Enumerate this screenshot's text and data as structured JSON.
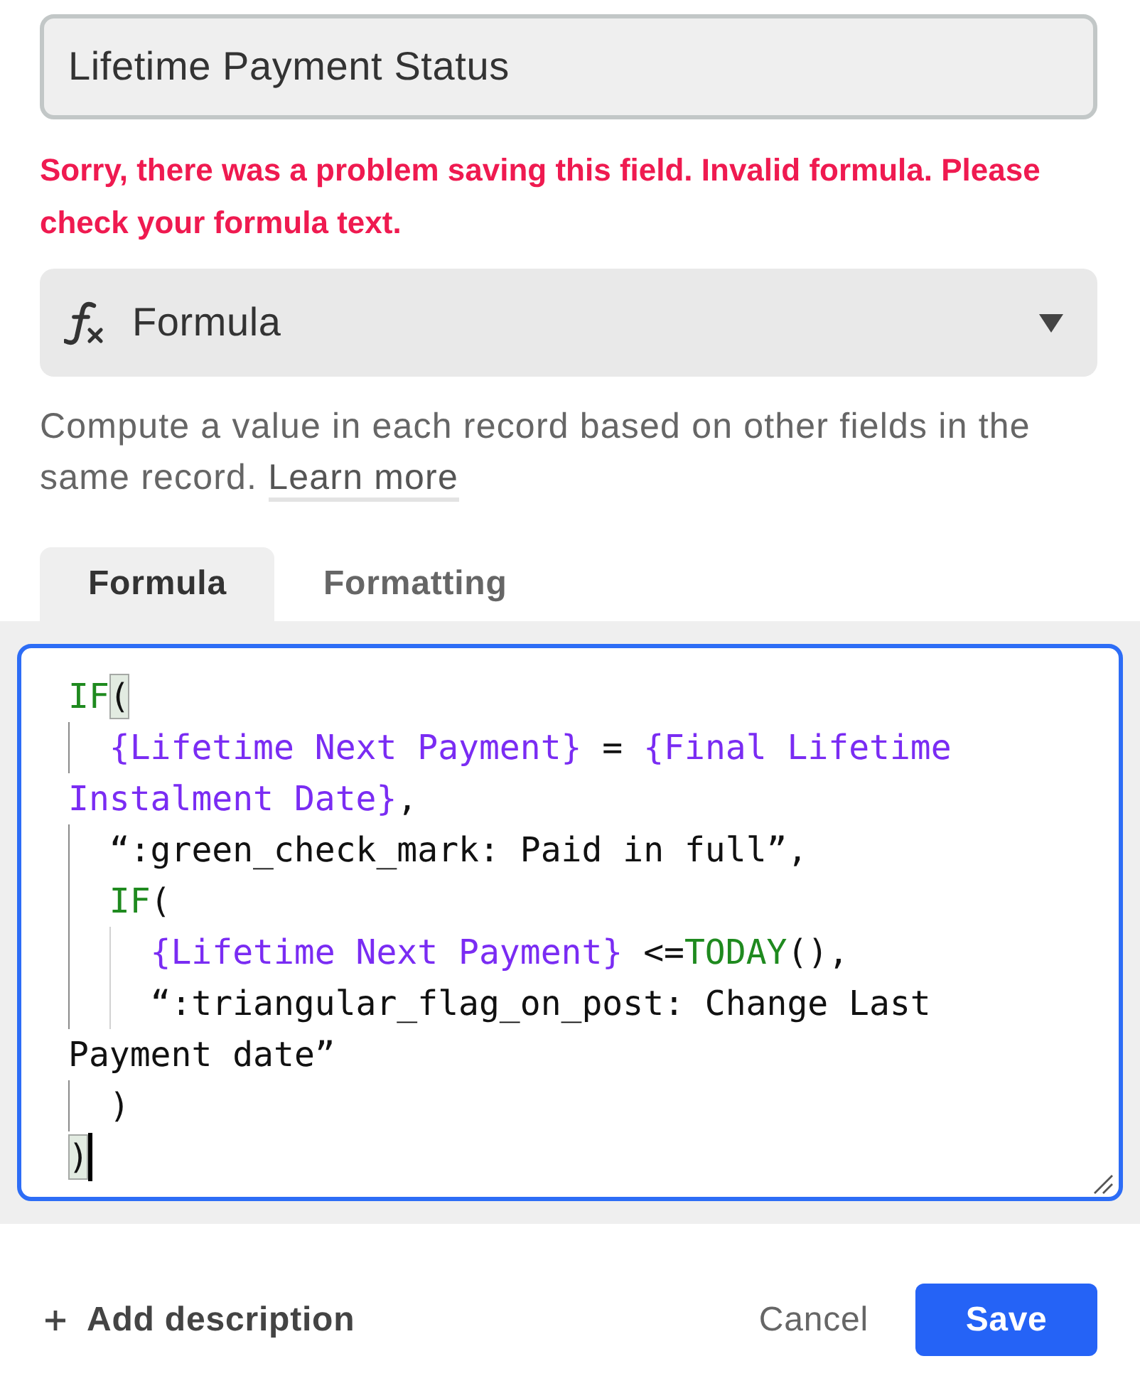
{
  "field_name": {
    "value": "Lifetime Payment Status"
  },
  "error_message": "Sorry, there was a problem saving this field. Invalid formula. Please check your formula text.",
  "field_type": {
    "label": "Formula"
  },
  "description": {
    "text": "Compute a value in each record based on other fields in the same record.",
    "link": "Learn more"
  },
  "tabs": [
    {
      "label": "Formula",
      "selected": true
    },
    {
      "label": "Formatting",
      "selected": false
    }
  ],
  "formula_editor": {
    "lines": [
      {
        "tokens": [
          {
            "kind": "function",
            "text": "IF"
          },
          {
            "kind": "matched_bracket",
            "text": "("
          }
        ]
      },
      {
        "tokens": [
          {
            "kind": "indent",
            "highlighted": true
          },
          {
            "kind": "field",
            "text": "{Lifetime Next Payment}"
          },
          {
            "kind": "plain",
            "text": " = "
          },
          {
            "kind": "field",
            "text": "{Final Lifetime Instalment Date}"
          },
          {
            "kind": "plain",
            "text": ","
          }
        ]
      },
      {
        "tokens": [
          {
            "kind": "indent",
            "highlighted": true
          },
          {
            "kind": "plain",
            "text": "“:green_check_mark: Paid in full”,"
          }
        ]
      },
      {
        "tokens": [
          {
            "kind": "indent",
            "highlighted": true
          },
          {
            "kind": "function",
            "text": "IF"
          },
          {
            "kind": "plain",
            "text": "("
          }
        ]
      },
      {
        "tokens": [
          {
            "kind": "indent",
            "highlighted": true
          },
          {
            "kind": "indent",
            "highlighted": false
          },
          {
            "kind": "field",
            "text": "{Lifetime Next Payment}"
          },
          {
            "kind": "plain",
            "text": " <="
          },
          {
            "kind": "function",
            "text": "TODAY"
          },
          {
            "kind": "plain",
            "text": "(),"
          }
        ]
      },
      {
        "tokens": [
          {
            "kind": "indent",
            "highlighted": true
          },
          {
            "kind": "indent",
            "highlighted": false
          },
          {
            "kind": "plain",
            "text": "“:triangular_flag_on_post: Change Last Payment date”"
          }
        ]
      },
      {
        "tokens": [
          {
            "kind": "indent",
            "highlighted": true
          },
          {
            "kind": "plain",
            "text": ")"
          }
        ]
      },
      {
        "tokens": [
          {
            "kind": "matched_bracket",
            "text": ")"
          },
          {
            "kind": "cursor"
          }
        ]
      }
    ]
  },
  "footer": {
    "add_description": "Add description",
    "cancel": "Cancel",
    "save": "Save"
  }
}
